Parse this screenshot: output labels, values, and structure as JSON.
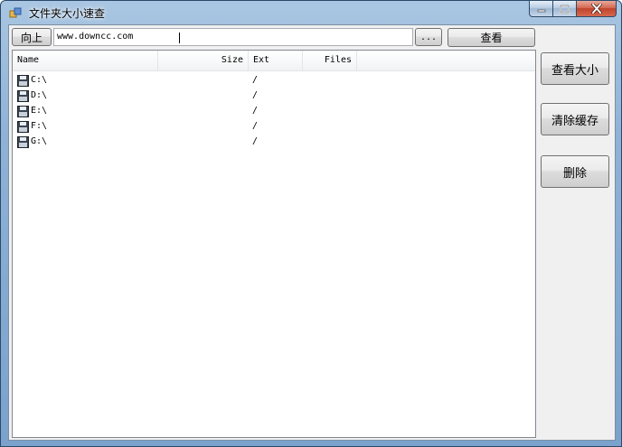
{
  "window": {
    "title": "文件夹大小速查"
  },
  "toolbar": {
    "up_label": "向上",
    "path_value": "www.downcc.com",
    "browse_label": "...",
    "view_label": "查看"
  },
  "list": {
    "columns": [
      "Name",
      "Size",
      "Ext",
      "Files"
    ],
    "rows": [
      {
        "name": "C:\\",
        "size": "",
        "ext": "/",
        "files": ""
      },
      {
        "name": "D:\\",
        "size": "",
        "ext": "/",
        "files": ""
      },
      {
        "name": "E:\\",
        "size": "",
        "ext": "/",
        "files": ""
      },
      {
        "name": "F:\\",
        "size": "",
        "ext": "/",
        "files": ""
      },
      {
        "name": "G:\\",
        "size": "",
        "ext": "/",
        "files": ""
      }
    ],
    "row_icon": "floppy-drive-icon"
  },
  "side_buttons": {
    "view_size_label": "查看大小",
    "clear_cache_label": "清除缓存",
    "delete_label": "删除"
  },
  "colors": {
    "frame": "#8fb2d6",
    "client_bg": "#f0f0f0",
    "close_button": "#c0442b"
  }
}
